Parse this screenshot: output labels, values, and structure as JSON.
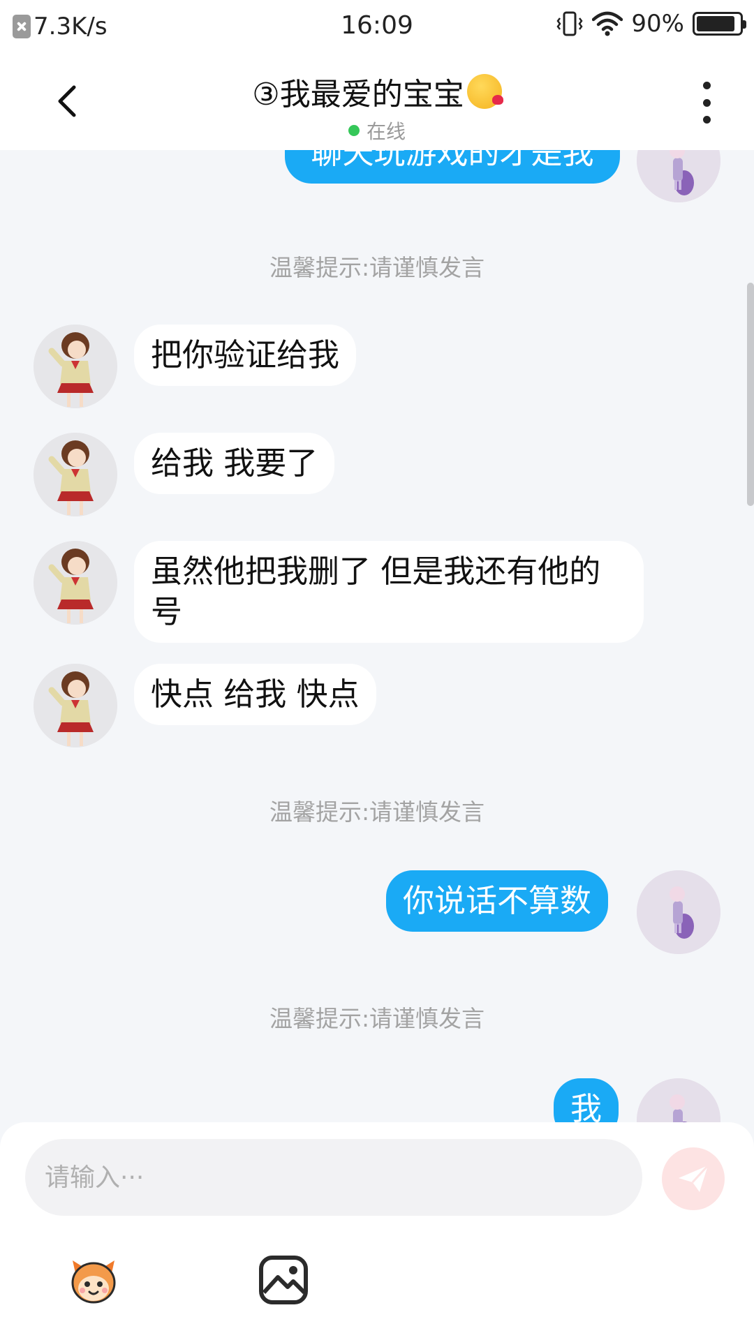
{
  "status_bar": {
    "net_speed": "7.3K/s",
    "time": "16:09",
    "battery": "90%",
    "battery_level": 0.9
  },
  "header": {
    "title": "③我最爱的宝宝",
    "title_emoji": "kissing-face-emoji",
    "status": "在线"
  },
  "messages": [
    {
      "dir": "out",
      "text": "聊天玩游戏的才是我",
      "partial": true
    },
    {
      "dir": "tip",
      "text": "温馨提示:请谨慎发言"
    },
    {
      "dir": "in",
      "text": "把你验证给我"
    },
    {
      "dir": "in",
      "text": "给我 我要了"
    },
    {
      "dir": "in",
      "text": "虽然他把我删了 但是我还有他的号"
    },
    {
      "dir": "in",
      "text": "快点 给我 快点"
    },
    {
      "dir": "tip",
      "text": "温馨提示:请谨慎发言"
    },
    {
      "dir": "out",
      "text": "你说话不算数"
    },
    {
      "dir": "tip",
      "text": "温馨提示:请谨慎发言"
    },
    {
      "dir": "out",
      "text": "我",
      "partial": true
    }
  ],
  "composer": {
    "placeholder": "请输入···",
    "send_icon": "paper-plane-icon",
    "tools": [
      "emoji-sticker-icon",
      "image-icon"
    ]
  },
  "colors": {
    "outgoing_bubble": "#1aaaf5",
    "incoming_bubble": "#ffffff",
    "background": "#f4f6f9",
    "online": "#35c759",
    "send_button": "#fde3e3"
  }
}
